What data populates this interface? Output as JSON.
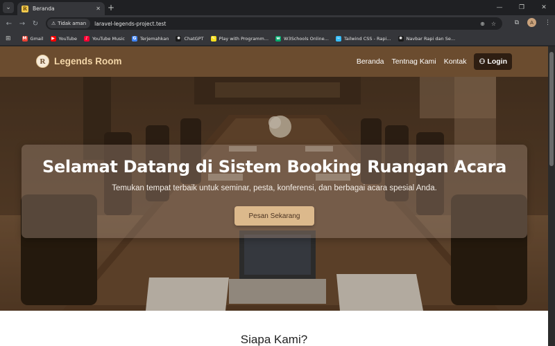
{
  "browser": {
    "tab_title": "Beranda",
    "tab_favicon": "R",
    "security_label": "Tidak aman",
    "url": "laravel-legends-project.test",
    "profile_initial": "A"
  },
  "bookmarks": [
    {
      "label": "Gmail",
      "color": "#ea4335",
      "glyph": "M"
    },
    {
      "label": "YouTube",
      "color": "#ff0000",
      "glyph": "▶"
    },
    {
      "label": "YouTube Music",
      "color": "#ff0033",
      "glyph": "♪"
    },
    {
      "label": "Terjemahkan",
      "color": "#4285f4",
      "glyph": "G"
    },
    {
      "label": "ChatGPT",
      "color": "#1a1a1a",
      "glyph": "✺"
    },
    {
      "label": "Play with Programm...",
      "color": "#f7df1e",
      "glyph": "✎"
    },
    {
      "label": "W3Schools Online...",
      "color": "#04aa6d",
      "glyph": "w"
    },
    {
      "label": "Tailwind CSS - Rapi...",
      "color": "#38bdf8",
      "glyph": "~"
    },
    {
      "label": "Navbar Rapi dan Se...",
      "color": "#1a1a1a",
      "glyph": "✺"
    }
  ],
  "site": {
    "brand_initial": "R",
    "brand_name": "Legends Room",
    "nav": {
      "home": "Beranda",
      "about": "Tentnag Kami",
      "contact": "Kontak",
      "login": "Login"
    },
    "hero": {
      "title": "Selamat Datang di Sistem Booking Ruangan Acara",
      "subtitle": "Temukan tempat terbaik untuk seminar, pesta, konferensi, dan berbagai acara spesial Anda.",
      "cta": "Pesan Sekarang"
    },
    "section_title": "Siapa Kami?"
  },
  "colors": {
    "nav_bg": "#6b4c2f",
    "brand_text": "#f3d6a8",
    "login_bg": "#2e1e12",
    "cta_bg": "#dcb98c"
  }
}
